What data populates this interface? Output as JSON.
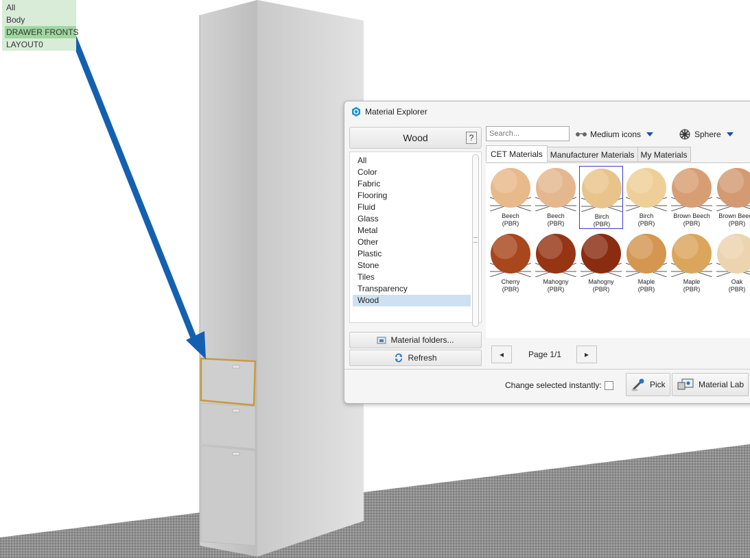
{
  "layers": [
    {
      "label": "All",
      "selected": false
    },
    {
      "label": "Body",
      "selected": false
    },
    {
      "label": "DRAWER FRONTS",
      "selected": true
    },
    {
      "label": "LAYOUT0",
      "selected": false
    }
  ],
  "dialog": {
    "title": "Material Explorer",
    "category_title": "Wood",
    "help_label": "?",
    "categories": [
      {
        "label": "All",
        "selected": false
      },
      {
        "label": "Color",
        "selected": false
      },
      {
        "label": "Fabric",
        "selected": false
      },
      {
        "label": "Flooring",
        "selected": false
      },
      {
        "label": "Fluid",
        "selected": false
      },
      {
        "label": "Glass",
        "selected": false
      },
      {
        "label": "Metal",
        "selected": false
      },
      {
        "label": "Other",
        "selected": false
      },
      {
        "label": "Plastic",
        "selected": false
      },
      {
        "label": "Stone",
        "selected": false
      },
      {
        "label": "Tiles",
        "selected": false
      },
      {
        "label": "Transparency",
        "selected": false
      },
      {
        "label": "Wood",
        "selected": true
      }
    ],
    "material_folders_label": "Material folders...",
    "refresh_label": "Refresh",
    "search_placeholder": "Search...",
    "view_dropdown": "Medium icons",
    "shape_dropdown": "Sphere",
    "tabs": [
      {
        "label": "CET Materials",
        "active": true
      },
      {
        "label": "Manufacturer Materials",
        "active": false
      },
      {
        "label": "My Materials",
        "active": false
      }
    ],
    "materials": [
      {
        "name": "Beech",
        "sub": "(PBR)",
        "color": "#e8b98a",
        "selected": false
      },
      {
        "name": "Beech",
        "sub": "(PBR)",
        "color": "#e4b78e",
        "selected": false
      },
      {
        "name": "Birch",
        "sub": "(PBR)",
        "color": "#e8c48a",
        "selected": true
      },
      {
        "name": "Birch",
        "sub": "(PBR)",
        "color": "#efcf98",
        "selected": false
      },
      {
        "name": "Brown Beech",
        "sub": "(PBR)",
        "color": "#d89e73",
        "selected": false
      },
      {
        "name": "Brown Beech",
        "sub": "(PBR)",
        "color": "#d49a72",
        "selected": false
      },
      {
        "name": "Cherry",
        "sub": "(PBR)",
        "color": "#a8461c",
        "selected": false
      },
      {
        "name": "Mahogny",
        "sub": "(PBR)",
        "color": "#953514",
        "selected": false
      },
      {
        "name": "Mahogny",
        "sub": "(PBR)",
        "color": "#8a2c10",
        "selected": false
      },
      {
        "name": "Maple",
        "sub": "(PBR)",
        "color": "#d49650",
        "selected": false
      },
      {
        "name": "Maple",
        "sub": "(PBR)",
        "color": "#dba55c",
        "selected": false
      },
      {
        "name": "Oak",
        "sub": "(PBR)",
        "color": "#ecd4ae",
        "selected": false
      }
    ],
    "page_label": "Page 1/1",
    "prev_label": "◂",
    "next_label": "▸",
    "instant_label": "Change selected instantly:",
    "pick_label": "Pick",
    "lab_label": "Material Lab"
  }
}
